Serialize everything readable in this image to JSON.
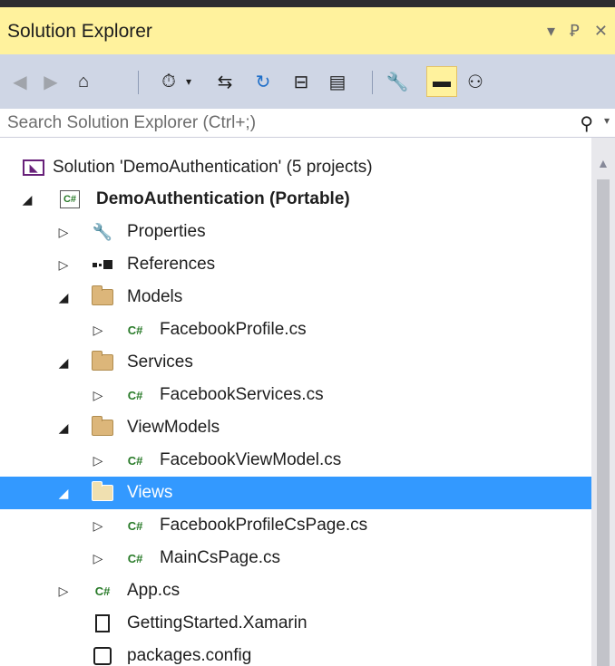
{
  "panel": {
    "title": "Solution Explorer",
    "controls": {
      "dropdown": "▾",
      "pin": "Ꝑ",
      "close": "✕"
    }
  },
  "toolbar": {
    "back_icon": "◀",
    "forward_icon": "▶",
    "home_icon": "⌂",
    "pending_icon": "⏱",
    "pending_dd": "▾",
    "sync_icon": "⇆",
    "refresh_icon": "↻",
    "collapse_icon": "⊟",
    "show_all_icon": "▤",
    "properties_icon": "🔧",
    "preview_icon": "▬",
    "class_diagram_icon": "⚇"
  },
  "search": {
    "placeholder": "Search Solution Explorer (Ctrl+;)",
    "icon": "⚲",
    "dropdown": "▾"
  },
  "tree": {
    "solution": "Solution 'DemoAuthentication' (5 projects)",
    "project": "DemoAuthentication (Portable)",
    "csbox": "C#",
    "cs": "C#",
    "properties": "Properties",
    "references": "References",
    "models": "Models",
    "facebook_profile": "FacebookProfile.cs",
    "services": "Services",
    "facebook_services": "FacebookServices.cs",
    "viewmodels": "ViewModels",
    "facebook_viewmodel": "FacebookViewModel.cs",
    "views": "Views",
    "facebook_profile_page": "FacebookProfileCsPage.cs",
    "main_page": "MainCsPage.cs",
    "app": "App.cs",
    "getting_started": "GettingStarted.Xamarin",
    "packages": "packages.config",
    "expanded_glyph": "◢",
    "collapsed_glyph": "▷"
  },
  "colors": {
    "title_bg": "#fff29d",
    "toolbar_bg": "#cfd6e5",
    "selection": "#3399ff",
    "folder": "#dcb67a",
    "csharp": "#287a28"
  }
}
